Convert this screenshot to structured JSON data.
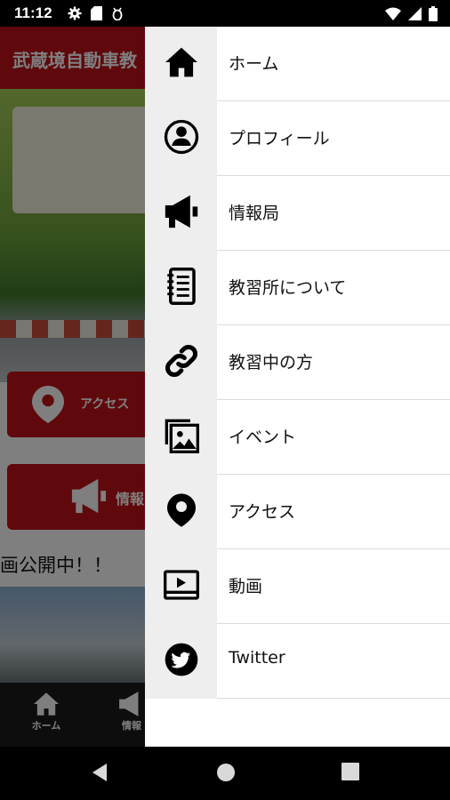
{
  "status_bar": {
    "time": "11:12",
    "left_icons": [
      "gear-icon",
      "sd-card-icon",
      "bug-icon"
    ],
    "right_icons": [
      "wifi-icon",
      "signal-icon",
      "battery-icon"
    ]
  },
  "app": {
    "header_title": "武蔵境自動車教",
    "buttons": {
      "access": "アクセス",
      "info": "情報"
    },
    "marquee": "画公開中！！",
    "bottom_nav": {
      "home": "ホーム",
      "info": "情報"
    },
    "accent_color": "#c0121a"
  },
  "drawer": {
    "items": [
      {
        "label": "ホーム",
        "icon": "home-icon"
      },
      {
        "label": "プロフィール",
        "icon": "profile-icon"
      },
      {
        "label": "情報局",
        "icon": "megaphone-icon"
      },
      {
        "label": "教習所について",
        "icon": "notebook-icon"
      },
      {
        "label": "教習中の方",
        "icon": "link-icon"
      },
      {
        "label": "イベント",
        "icon": "image-gallery-icon"
      },
      {
        "label": "アクセス",
        "icon": "location-pin-icon"
      },
      {
        "label": "動画",
        "icon": "video-icon"
      },
      {
        "label": "Twitter",
        "icon": "twitter-icon"
      }
    ]
  },
  "nav_bar": {
    "icons": [
      "back-icon",
      "home-circle-icon",
      "recents-icon"
    ]
  }
}
